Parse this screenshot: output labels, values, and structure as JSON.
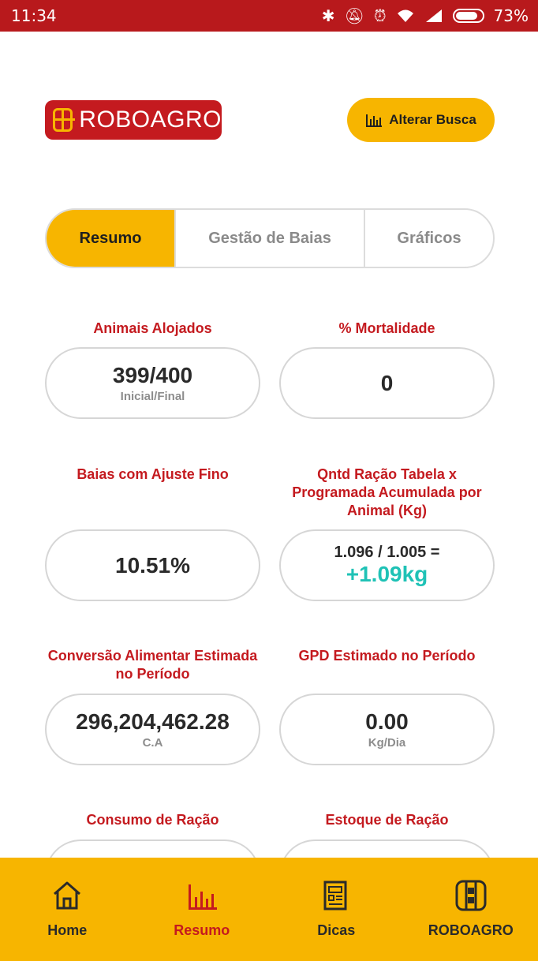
{
  "status_bar": {
    "time": "11:34",
    "icons": [
      "bluetooth-icon",
      "mute-icon",
      "alarm-icon",
      "wifi-icon",
      "signal-icon"
    ],
    "battery": "73%"
  },
  "header": {
    "logo_text": "ROBOAGRO",
    "search_button": "Alterar Busca"
  },
  "tabs": [
    {
      "label": "Resumo",
      "active": true
    },
    {
      "label": "Gestão de Baias",
      "active": false
    },
    {
      "label": "Gráficos",
      "active": false
    }
  ],
  "metrics": {
    "animais": {
      "title": "Animais Alojados",
      "value": "399/400",
      "sub": "Inicial/Final"
    },
    "mortalidade": {
      "title": "% Mortalidade",
      "value": "0"
    },
    "ajuste": {
      "title": "Baias com Ajuste Fino",
      "value": "10.51%"
    },
    "racao": {
      "title": "Qntd Ração Tabela x Programada Acumulada por Animal (Kg)",
      "line": "1.096 / 1.005 =",
      "diff": "+1.09kg"
    },
    "conversao": {
      "title": "Conversão Alimentar Estimada no Período",
      "value": "296,204,462.28",
      "sub": "C.A"
    },
    "gpd": {
      "title": "GPD Estimado no Período",
      "value": "0.00",
      "sub": "Kg/Dia"
    },
    "consumo": {
      "title": "Consumo de Ração"
    },
    "estoque": {
      "title": "Estoque de Ração"
    }
  },
  "bottom_nav": [
    {
      "label": "Home",
      "icon": "home-icon",
      "active": false
    },
    {
      "label": "Resumo",
      "icon": "chart-icon",
      "active": true
    },
    {
      "label": "Dicas",
      "icon": "document-icon",
      "active": false
    },
    {
      "label": "ROBOAGRO",
      "icon": "roboagro-icon",
      "active": false
    }
  ],
  "colors": {
    "brand_red": "#c41a1f",
    "accent_yellow": "#f7b500",
    "teal": "#1fc2b6"
  }
}
